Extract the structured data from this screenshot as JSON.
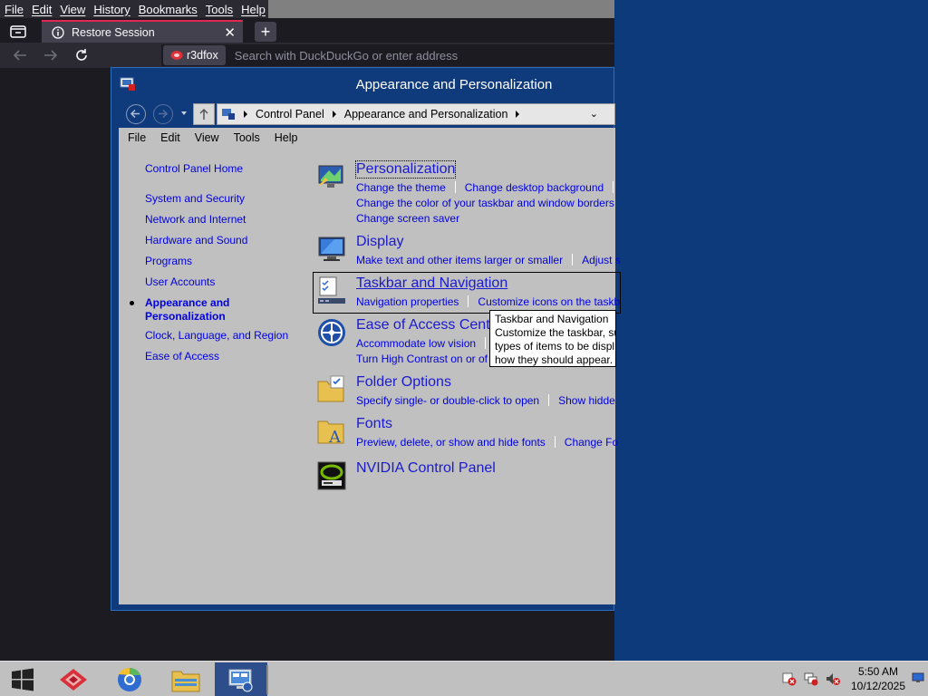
{
  "browser": {
    "menu": [
      "File",
      "Edit",
      "View",
      "History",
      "Bookmarks",
      "Tools",
      "Help"
    ],
    "tab_title": "Restore Session",
    "new_tab_label": "+",
    "identity_label": "r3dfox",
    "url_placeholder": "Search with DuckDuckGo or enter address"
  },
  "control_panel": {
    "title": "Appearance and Personalization",
    "breadcrumb": [
      "Control Panel",
      "Appearance and Personalization"
    ],
    "menu": [
      "File",
      "Edit",
      "View",
      "Tools",
      "Help"
    ],
    "sidebar": {
      "home": "Control Panel Home",
      "items": [
        "System and Security",
        "Network and Internet",
        "Hardware and Sound",
        "Programs",
        "User Accounts"
      ],
      "current_line1": "Appearance and",
      "current_line2": "Personalization",
      "items_after": [
        "Clock, Language, and Region",
        "Ease of Access"
      ]
    },
    "categories": {
      "personalization": {
        "title": "Personalization",
        "links": [
          "Change the theme",
          "Change desktop background",
          "Change the color of your taskbar and window borders",
          "Change screen saver"
        ]
      },
      "display": {
        "title": "Display",
        "links": [
          "Make text and other items larger or smaller",
          "Adjust s"
        ]
      },
      "taskbar": {
        "title": "Taskbar and Navigation",
        "links": [
          "Navigation properties",
          "Customize icons on the taskb"
        ]
      },
      "ease": {
        "title": "Ease of Access Center",
        "links": [
          "Accommodate low vision",
          "Turn High Contrast on or of"
        ]
      },
      "folder": {
        "title": "Folder Options",
        "links": [
          "Specify single- or double-click to open",
          "Show hidde"
        ]
      },
      "fonts": {
        "title": "Fonts",
        "links": [
          "Preview, delete, or show and hide fonts",
          "Change Fo"
        ]
      },
      "nvidia": {
        "title": "NVIDIA Control Panel"
      }
    },
    "tooltip": [
      "Taskbar and Navigation",
      "Customize the taskbar, su",
      "types of items to be displ",
      "how they should appear."
    ]
  },
  "taskbar": {
    "time": "5:50 AM",
    "date": "10/12/2025"
  },
  "colors": {
    "desktop": "#0d3a7a",
    "link": "#0000e0",
    "tab_accent": "#e22850"
  }
}
